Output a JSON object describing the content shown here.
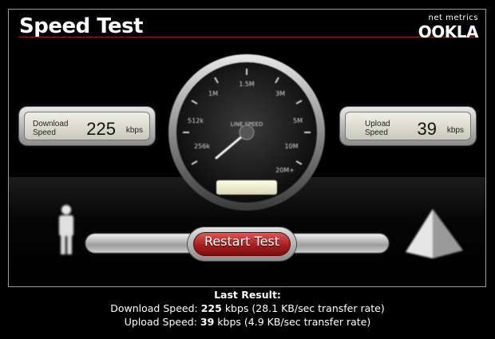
{
  "header": {
    "title": "Speed Test"
  },
  "logo": {
    "tagline": "net metrics",
    "brand": "OOKLA"
  },
  "download_panel": {
    "label_line1": "Download",
    "label_line2": "Speed",
    "value": "225",
    "unit": "kbps"
  },
  "upload_panel": {
    "label_line1": "Upload",
    "label_line2": "Speed",
    "value": "39",
    "unit": "kbps"
  },
  "gauge": {
    "center_label": "LINE SPEED",
    "ticks": [
      "256k",
      "512k",
      "1M",
      "1.5M",
      "3M",
      "5M",
      "10M",
      "20M+"
    ]
  },
  "restart_button": {
    "label": "Restart Test"
  },
  "results": {
    "heading": "Last Result:",
    "download_label": "Download Speed:",
    "download_value": "225",
    "download_unit": "kbps",
    "download_detail": "(28.1 KB/sec transfer rate)",
    "upload_label": "Upload Speed:",
    "upload_value": "39",
    "upload_unit": "kbps",
    "upload_detail": "(4.9 KB/sec transfer rate)"
  },
  "colors": {
    "accent_red": "#a51f1f",
    "rule_red": "#a01818",
    "background": "#000000"
  }
}
